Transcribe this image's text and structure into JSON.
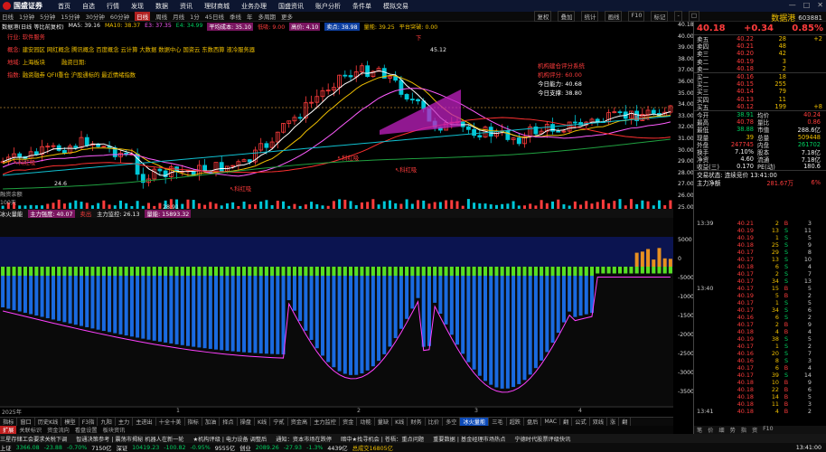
{
  "menubar": {
    "app_name": "国盛证券",
    "items": [
      "首页",
      "自选",
      "行情",
      "发现",
      "数据",
      "资讯",
      "理财商城",
      "业务办理",
      "国盛资讯",
      "账户分析",
      "条件单",
      "模拟交易"
    ],
    "controls": [
      "—",
      "□",
      "✕"
    ]
  },
  "toolbar": {
    "periods": [
      "日线",
      "1分钟",
      "5分钟",
      "15分钟",
      "30分钟",
      "60分钟",
      "日线",
      "周线",
      "月线",
      "1分",
      "45日线",
      "季线",
      "年",
      "多周期",
      "更多"
    ],
    "active_period_index": 6,
    "buttons": [
      "复权",
      "叠加",
      "统计",
      "画线",
      "F10",
      "标记",
      "-",
      "□"
    ]
  },
  "panel_title": {
    "name": "数据港",
    "code": "603881"
  },
  "legend_main": {
    "title": "数据港(日线 等比前复权)",
    "ma5": "MA5: 39.16",
    "ma10": "MA10: 38.37",
    "ma20": "E3: 37.35",
    "ma60": "E4: 34.99",
    "extra": "平均成本: 35.10",
    "extra2": "低吸: 9.00",
    "extra3": "高价: 4.10",
    "signal": "卖点: 38.98",
    "tag1": "量能: 39.25",
    "tag2": "平台突破: 0.00"
  },
  "annotations": {
    "row1_label": "行业:",
    "row1_val": "软件服务",
    "row2_label": "概念:",
    "row2_val": "建安园区 网红概念 腾讯概念 百度概念 云计算 大数据 数据中心 国资云 东数西算 液冷服务器",
    "row3_label": "地域:",
    "row3_val": "上海板块",
    "row3_label2": "融资日期:",
    "row4_label": "指数:",
    "row4_val": "融资融券 QFII重仓 沪股通标的 最近情绪指数"
  },
  "eval_box": {
    "title": "机构建仓评分系统",
    "l1_label": "机构评分:",
    "l1_val": "60.00",
    "l2_label": "今日能力:",
    "l2_val": "40.68",
    "l3_label": "今日支撑:",
    "l3_val": "38.80"
  },
  "chart_labels": {
    "peak": "45.12",
    "low1": "28.91",
    "low2": "24.6",
    "buy1": "↖科红吸",
    "buy2": "↖科红吸",
    "buy3": "↖科红吸",
    "buy4": "↖科红吸",
    "sell1": "吸",
    "sell2": "猫出",
    "sell3": "下",
    "sell4": "吸点域"
  },
  "price_scale": [
    "40.18",
    "40.00",
    "39.00",
    "38.00",
    "37.00",
    "36.00",
    "35.00",
    "34.00",
    "33.00",
    "32.00",
    "31.00",
    "30.00",
    "29.00",
    "28.00",
    "27.00",
    "26.00",
    "25.00"
  ],
  "vol_labels": {
    "a": "融资余额",
    "b": "100天"
  },
  "subchart_header": {
    "title": "冰火量能",
    "i1": "主力强度: 40.07",
    "i2": "卖出",
    "i3": "主力监控: 26.13",
    "i4": "量能: 15893.32"
  },
  "low_scale": [
    "5000",
    "0",
    "-5000",
    "-10000",
    "-15000",
    "-20000",
    "-25000",
    "-30000",
    "-35000"
  ],
  "x_axis": {
    "year": "2025年",
    "months": [
      "1",
      "2",
      "3",
      "4"
    ]
  },
  "bottom_tabs": [
    "指标",
    "窗口",
    "历史K线",
    "模型",
    "F3指",
    "九阳",
    "主力",
    "主进出",
    "十全十美",
    "指标",
    "加油",
    "择点",
    "操盘",
    "K线",
    "宁贰",
    "资金高",
    "主力监控",
    "资金",
    "动能",
    "量缺",
    "K线",
    "财务",
    "比价",
    "多空",
    "冰火量能",
    "三毛",
    "超跌",
    "盘后",
    "MAC",
    "翻",
    "公式",
    "双线",
    "涨",
    "翻"
  ],
  "bottom_tabs_active": 24,
  "bottom_tabs2": [
    "扩展",
    "关联标识",
    "资金流向",
    "看盘设置",
    "板块资讯"
  ],
  "ticker": [
    "三星存储工会要求关税下调",
    "智通决策参考 | 震荡市揭秘 机器人在新一轮",
    "★机构评级 | 电力设备 调整后",
    "通知：资本市场在跌停",
    "暗中★找寻机会 | 苍梧：重点问题",
    "重要数据 | 基金经理市场热点",
    "宁德时代股票评级快讯"
  ],
  "status": {
    "index1_name": "上证",
    "index1_val": "3366.08",
    "index1_chg": "-23.88",
    "index1_pct": "-0.70%",
    "index1_amt": "7150亿",
    "index2_name": "深证",
    "index2_val": "10419.23",
    "index2_chg": "-100.82",
    "index2_pct": "-0.95%",
    "index2_amt": "9555亿",
    "index3_name": "创业",
    "index3_val": "2089.26",
    "index3_chg": "-27.93",
    "index3_pct": "-1.3%",
    "index3_amt": "4439亿",
    "total": "总成交16805亿",
    "time": "13:41:00"
  },
  "quote_header": {
    "price": "40.18",
    "change": "+0.34",
    "pct": "0.85%"
  },
  "quote": {
    "asks": [
      {
        "l": "卖五",
        "p": "40.22",
        "v": "28",
        "x": "+2"
      },
      {
        "l": "卖四",
        "p": "40.21",
        "v": "48",
        "x": ""
      },
      {
        "l": "卖三",
        "p": "40.20",
        "v": "42",
        "x": ""
      },
      {
        "l": "卖二",
        "p": "40.19",
        "v": "3",
        "x": ""
      },
      {
        "l": "卖一",
        "p": "40.18",
        "v": "2",
        "x": ""
      }
    ],
    "bids": [
      {
        "l": "买一",
        "p": "40.16",
        "v": "18",
        "x": ""
      },
      {
        "l": "买二",
        "p": "40.15",
        "v": "255",
        "x": ""
      },
      {
        "l": "买三",
        "p": "40.14",
        "v": "79",
        "x": ""
      },
      {
        "l": "买四",
        "p": "40.13",
        "v": "11",
        "x": ""
      },
      {
        "l": "买五",
        "p": "40.12",
        "v": "199",
        "x": "+8"
      }
    ],
    "stats": [
      {
        "a": "今开",
        "b": "38.91",
        "bc": "grn",
        "c": "均价",
        "d": "40.24",
        "dc": "red"
      },
      {
        "a": "最高",
        "b": "40.78",
        "bc": "red",
        "c": "量比",
        "d": "0.86",
        "dc": "red"
      },
      {
        "a": "最低",
        "b": "38.88",
        "bc": "grn",
        "c": "市值",
        "d": "288.6亿",
        "dc": "wht"
      },
      {
        "a": "现量",
        "b": "39",
        "bc": "yel",
        "c": "总量",
        "d": "509448",
        "dc": "yel"
      },
      {
        "a": "外盘",
        "b": "247745",
        "bc": "red",
        "c": "内盘",
        "d": "261702",
        "dc": "grn"
      },
      {
        "a": "换手",
        "b": "7.10%",
        "bc": "wht",
        "c": "股本",
        "d": "7.18亿",
        "dc": "wht"
      },
      {
        "a": "净资",
        "b": "4.60",
        "bc": "wht",
        "c": "流通",
        "d": "7.18亿",
        "dc": "wht"
      },
      {
        "a": "收益(三)",
        "b": "0.170",
        "bc": "wht",
        "c": "PE(动)",
        "d": "180.6",
        "dc": "wht"
      }
    ],
    "trade_state": "交易状态: 连续竞价 13:41:00",
    "main_net_label": "主力净额",
    "main_net_val": "281.67万",
    "main_net_pct": "6%"
  },
  "trades": [
    {
      "tm": "13:39",
      "pr": "40.21",
      "vl": "2",
      "sd": "B",
      "nm": "3"
    },
    {
      "tm": "",
      "pr": "40.19",
      "vl": "13",
      "sd": "S",
      "nm": "11"
    },
    {
      "tm": "",
      "pr": "40.19",
      "vl": "1",
      "sd": "S",
      "nm": "5"
    },
    {
      "tm": "",
      "pr": "40.18",
      "vl": "25",
      "sd": "S",
      "nm": "9"
    },
    {
      "tm": "",
      "pr": "40.17",
      "vl": "29",
      "sd": "S",
      "nm": "8"
    },
    {
      "tm": "",
      "pr": "40.17",
      "vl": "13",
      "sd": "S",
      "nm": "10"
    },
    {
      "tm": "",
      "pr": "40.18",
      "vl": "6",
      "sd": "S",
      "nm": "4"
    },
    {
      "tm": "",
      "pr": "40.17",
      "vl": "2",
      "sd": "S",
      "nm": "7"
    },
    {
      "tm": "",
      "pr": "40.17",
      "vl": "34",
      "sd": "S",
      "nm": "13"
    },
    {
      "tm": "13:40",
      "pr": "40.17",
      "vl": "15",
      "sd": "B",
      "nm": "5"
    },
    {
      "tm": "",
      "pr": "40.19",
      "vl": "5",
      "sd": "B",
      "nm": "2"
    },
    {
      "tm": "",
      "pr": "40.17",
      "vl": "1",
      "sd": "S",
      "nm": "5"
    },
    {
      "tm": "",
      "pr": "40.17",
      "vl": "34",
      "sd": "S",
      "nm": "6"
    },
    {
      "tm": "",
      "pr": "40.16",
      "vl": "6",
      "sd": "S",
      "nm": "2"
    },
    {
      "tm": "",
      "pr": "40.17",
      "vl": "2",
      "sd": "B",
      "nm": "9"
    },
    {
      "tm": "",
      "pr": "40.18",
      "vl": "4",
      "sd": "B",
      "nm": "4"
    },
    {
      "tm": "",
      "pr": "40.19",
      "vl": "38",
      "sd": "S",
      "nm": "5"
    },
    {
      "tm": "",
      "pr": "40.17",
      "vl": "1",
      "sd": "S",
      "nm": "2"
    },
    {
      "tm": "",
      "pr": "40.16",
      "vl": "20",
      "sd": "S",
      "nm": "7"
    },
    {
      "tm": "",
      "pr": "40.16",
      "vl": "8",
      "sd": "S",
      "nm": "3"
    },
    {
      "tm": "",
      "pr": "40.17",
      "vl": "6",
      "sd": "B",
      "nm": "4"
    },
    {
      "tm": "",
      "pr": "40.17",
      "vl": "39",
      "sd": "S",
      "nm": "14"
    },
    {
      "tm": "",
      "pr": "40.18",
      "vl": "10",
      "sd": "B",
      "nm": "9"
    },
    {
      "tm": "",
      "pr": "40.18",
      "vl": "22",
      "sd": "B",
      "nm": "6"
    },
    {
      "tm": "",
      "pr": "40.18",
      "vl": "14",
      "sd": "B",
      "nm": "5"
    },
    {
      "tm": "",
      "pr": "40.18",
      "vl": "11",
      "sd": "B",
      "nm": "3"
    },
    {
      "tm": "13:41",
      "pr": "40.18",
      "vl": "4",
      "sd": "B",
      "nm": "2"
    }
  ],
  "quote_tabs": [
    "笔",
    "价",
    "细",
    "势",
    "指",
    "资",
    "F10"
  ],
  "colors": {
    "up": "#ff3c3c",
    "down": "#00c8d8",
    "bg": "#000000",
    "accent": "#c02020"
  }
}
